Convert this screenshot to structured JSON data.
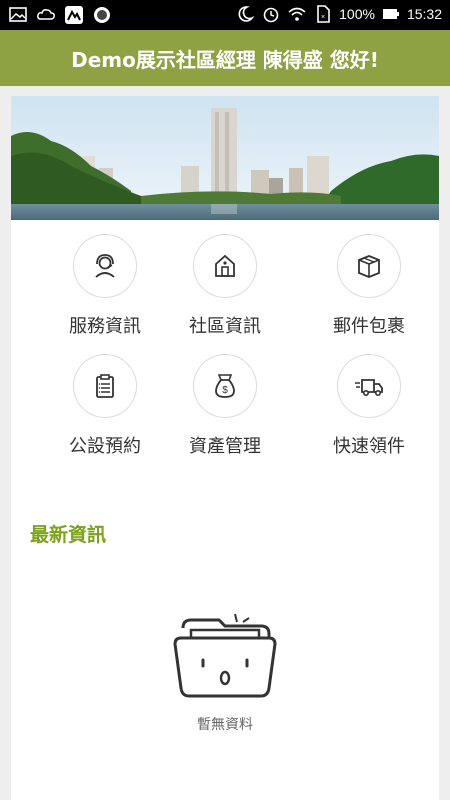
{
  "status_bar": {
    "battery": "100%",
    "time": "15:32",
    "left_icons": [
      "gallery-icon",
      "cloud-icon",
      "app-icon",
      "record-icon"
    ],
    "right_icons": [
      "moon-icon",
      "alarm-icon",
      "wifi-icon",
      "sim-icon",
      "battery-icon"
    ]
  },
  "header": {
    "title": "Demo展示社區經理 陳得盛 您好!"
  },
  "menu": [
    {
      "label": "服務資訊",
      "icon": "headset-user-icon"
    },
    {
      "label": "社區資訊",
      "icon": "house-icon"
    },
    {
      "label": "郵件包裹",
      "icon": "package-icon"
    },
    {
      "label": "公設預約",
      "icon": "clipboard-icon"
    },
    {
      "label": "資產管理",
      "icon": "money-bag-icon"
    },
    {
      "label": "快速領件",
      "icon": "delivery-truck-icon"
    }
  ],
  "news": {
    "title": "最新資訊",
    "empty_text": "暫無資料"
  },
  "colors": {
    "header": "#8ea243",
    "accent": "#7ca11c",
    "status_bar": "#000000"
  }
}
